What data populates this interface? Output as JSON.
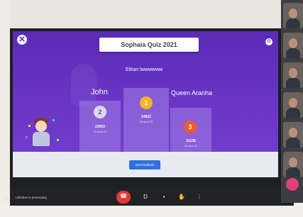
{
  "quiz": {
    "title": "Sophaia Quiz 2021",
    "close_glyph": "✕",
    "settings_glyph": "⚙"
  },
  "podium": [
    {
      "place": "2",
      "name": "John",
      "score": "23063",
      "sub": "16 out of 20",
      "medal_color": "#d9d9e6"
    },
    {
      "place": "1",
      "name": "Ethan lwwwwww",
      "score": "24022",
      "sub": "18 out of 20",
      "medal_color": "#f2b524"
    },
    {
      "place": "3",
      "name": "Queen Aranha",
      "score": "21138",
      "sub": "15 out of 20",
      "medal_color": "#ef5a2a"
    }
  ],
  "feedback_label": "Get feedback",
  "meeting": {
    "presenting_label": "Lillivibes is presenting",
    "controls": [
      "end-call",
      "captions",
      "mic",
      "raise-hand",
      "more"
    ],
    "control_glyphs": {
      "end": "☎",
      "captions": "D",
      "mic": "●",
      "hand": "✋",
      "more": "⋮"
    }
  },
  "colors": {
    "accent_purple": "#6b36c8",
    "end_call_red": "#e53935",
    "feedback_blue": "#2f6fe0"
  }
}
